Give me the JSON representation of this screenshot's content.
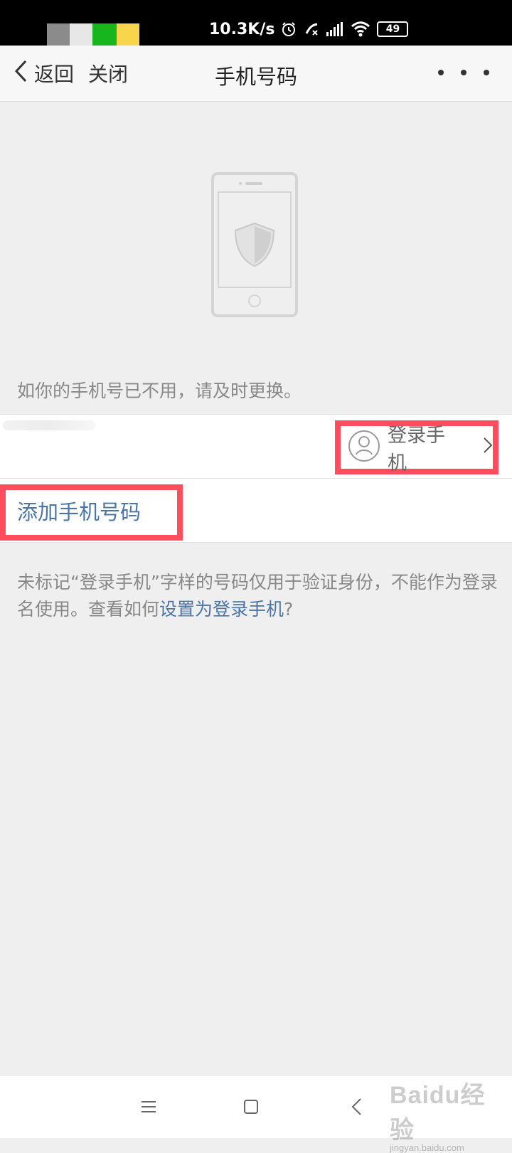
{
  "status_bar": {
    "network_speed": "10.3K/s",
    "battery_level": "49",
    "redaction_colors": [
      "#8b8b8b",
      "#e7e7e7",
      "#18b61e",
      "#f8d54b"
    ]
  },
  "header": {
    "back_label": "返回",
    "close_label": "关闭",
    "title": "手机号码"
  },
  "content": {
    "info_text": "如你的手机号已不用，请及时更换。",
    "login_phone_label": "登录手机",
    "add_phone_label": "添加手机号码",
    "notice_text": "未标记“登录手机”字样的号码仅用于验证身份，不能作为登录名使用。查看如何",
    "notice_link": "设置为登录手机",
    "notice_suffix": "?"
  },
  "icons": {
    "back": "chevron-left-icon",
    "more": "more-icon",
    "user": "user-icon",
    "chevron": "chevron-right-icon",
    "menu": "menu-icon",
    "home": "home-icon",
    "nav_back": "back-icon",
    "shield": "shield-icon"
  },
  "watermark": {
    "line1": "Baidu经验",
    "line2": "jingyan.baidu.com"
  },
  "colors": {
    "highlight": "#ff4d5d",
    "link": "#4b74a7"
  }
}
